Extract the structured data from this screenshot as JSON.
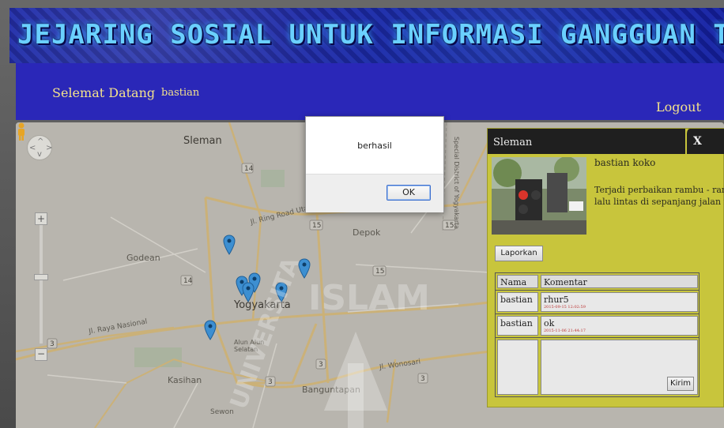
{
  "banner": {
    "title": "JEJARING SOSIAL UNTUK INFORMASI GANGGUAN TRANSPORTASI JALAN"
  },
  "nav": {
    "welcome": "Selemat Datang",
    "username": "bastian",
    "logout": "Logout"
  },
  "map": {
    "labels": {
      "sleman": "Sleman",
      "godean": "Godean",
      "depok": "Depok",
      "yogyakarta": "Yogyakarta",
      "banguntapan": "Banguntapan",
      "kasihan": "Kasihan",
      "ring_road_utara": "Jl. Ring Road Utara",
      "raya_nasional": "Jl. Raya Nasional",
      "jl_wonosari": "Jl. Wonosari",
      "alun_alun": "Alun Alun Selatan",
      "special_district": "Special District of Yogyakarta",
      "sewon": "Sewon"
    },
    "route_numbers": [
      "14",
      "15",
      "15",
      "15",
      "14",
      "3",
      "3",
      "3",
      "3"
    ]
  },
  "dialog": {
    "message": "berhasil",
    "ok_label": "OK"
  },
  "panel": {
    "title": "Sleman",
    "close_label": "X",
    "poster": "bastian koko",
    "description_lines": [
      "Terjadi perbaikan rambu - rambu",
      "lalu lintas di sepanjang jalan ringroad"
    ],
    "report_label": "Laporkan",
    "table": {
      "headers": [
        "Nama",
        "Komentar"
      ],
      "rows": [
        {
          "name": "bastian",
          "comment": "rhur5",
          "timestamp": "2015-09-15 12:02:59"
        },
        {
          "name": "bastian",
          "comment": "ok",
          "timestamp": "2015-11-06 21:44:17"
        }
      ]
    },
    "send_label": "Kirim"
  },
  "watermark": {
    "text": "ISLAM",
    "side_text": "UNIVERSITAS"
  },
  "colors": {
    "nav_bg": "#2a27b8",
    "nav_text": "#f3e28c",
    "panel_bg": "#c8c53c",
    "banner_text": "#6ad0ff",
    "marker": "#3d8fd1"
  }
}
